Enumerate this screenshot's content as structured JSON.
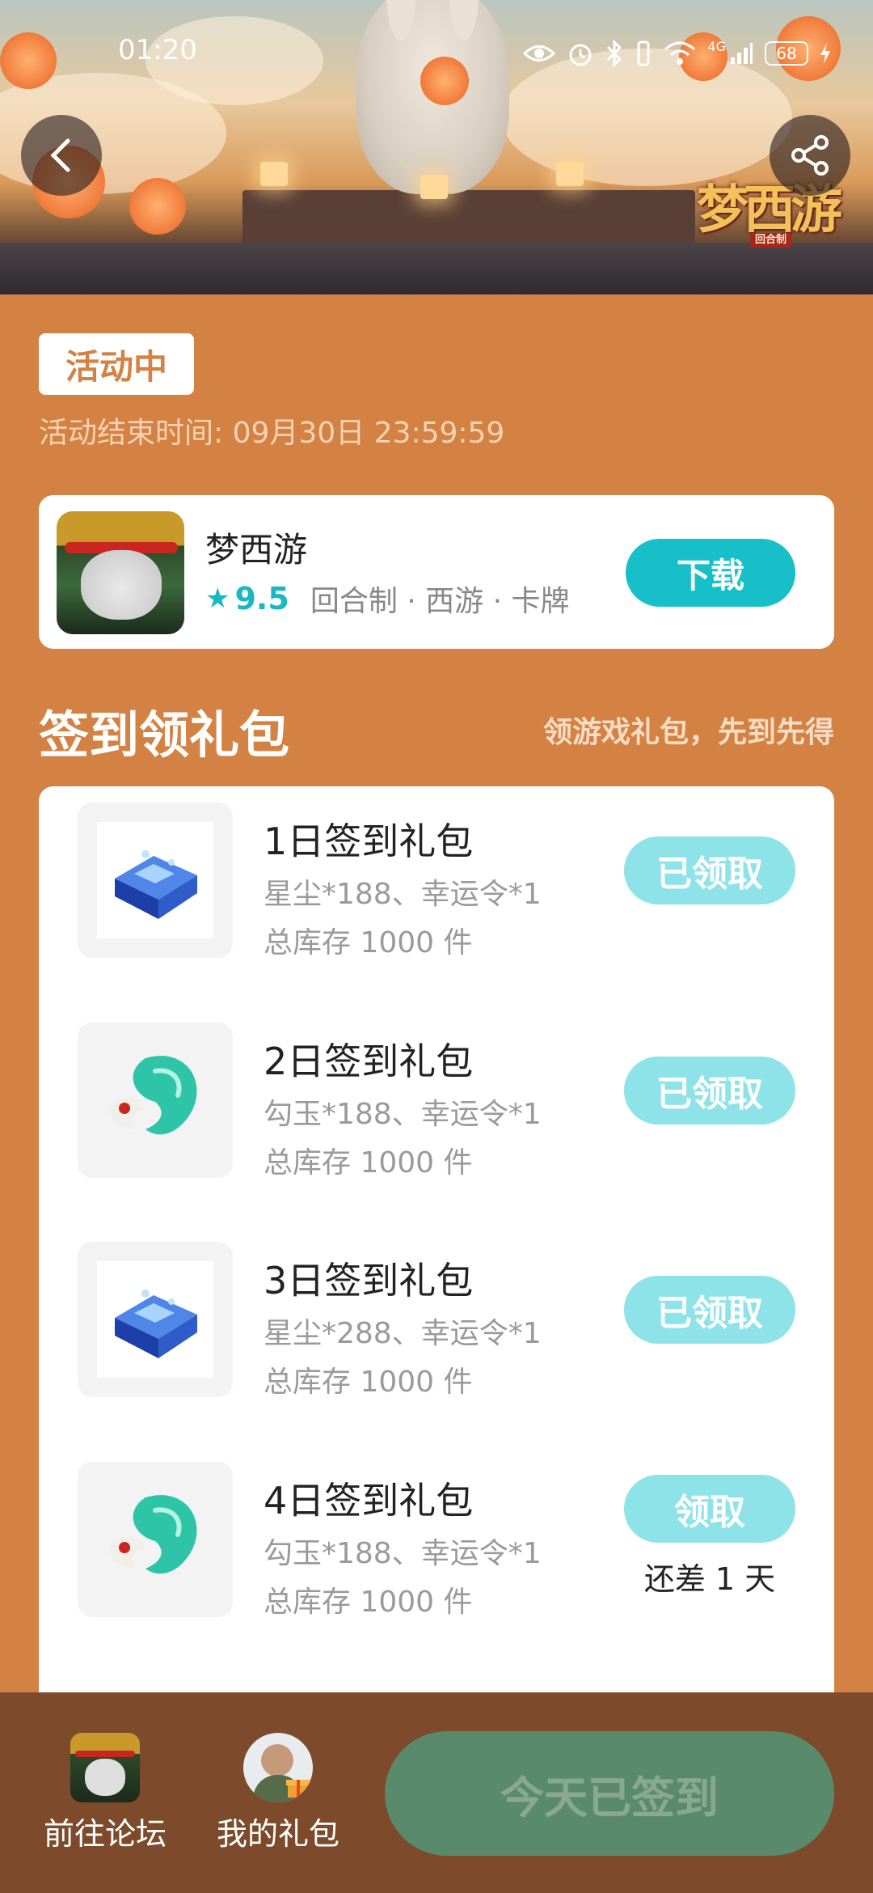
{
  "status_bar": {
    "time": "01:20",
    "battery": "68",
    "network": "4G"
  },
  "banner": {
    "logo_text": "梦西游",
    "logo_sub": "回合制"
  },
  "activity": {
    "status": "活动中",
    "end_time": "活动结束时间: 09月30日 23:59:59"
  },
  "game": {
    "name": "梦西游",
    "score": "9.5",
    "tags": "回合制 · 西游 · 卡牌",
    "download_label": "下载"
  },
  "section": {
    "title": "签到领礼包",
    "subtitle": "领游戏礼包，先到先得"
  },
  "gifts": [
    {
      "name": "1日签到礼包",
      "items": "星尘*188、幸运令*1",
      "stock": "总库存 1000 件",
      "button": "已领取",
      "remaining": "",
      "icon": "blue-crystal-chest-icon"
    },
    {
      "name": "2日签到礼包",
      "items": "勾玉*188、幸运令*1",
      "stock": "总库存 1000 件",
      "button": "已领取",
      "remaining": "",
      "icon": "jade-magatama-icon"
    },
    {
      "name": "3日签到礼包",
      "items": "星尘*288、幸运令*1",
      "stock": "总库存 1000 件",
      "button": "已领取",
      "remaining": "",
      "icon": "blue-crystal-chest-icon"
    },
    {
      "name": "4日签到礼包",
      "items": "勾玉*188、幸运令*1",
      "stock": "总库存 1000 件",
      "button": "领取",
      "remaining": "还差 1 天",
      "icon": "jade-magatama-icon"
    }
  ],
  "bottom_nav": {
    "forum_label": "前往论坛",
    "gifts_label": "我的礼包",
    "signed_label": "今天已签到"
  },
  "colors": {
    "background": "#d48244",
    "accent_teal": "#17bfc9",
    "claimed_button": "#8ee3e8",
    "bottom_bar": "#7d4b2b",
    "signed_button": "#5a8a6c"
  }
}
